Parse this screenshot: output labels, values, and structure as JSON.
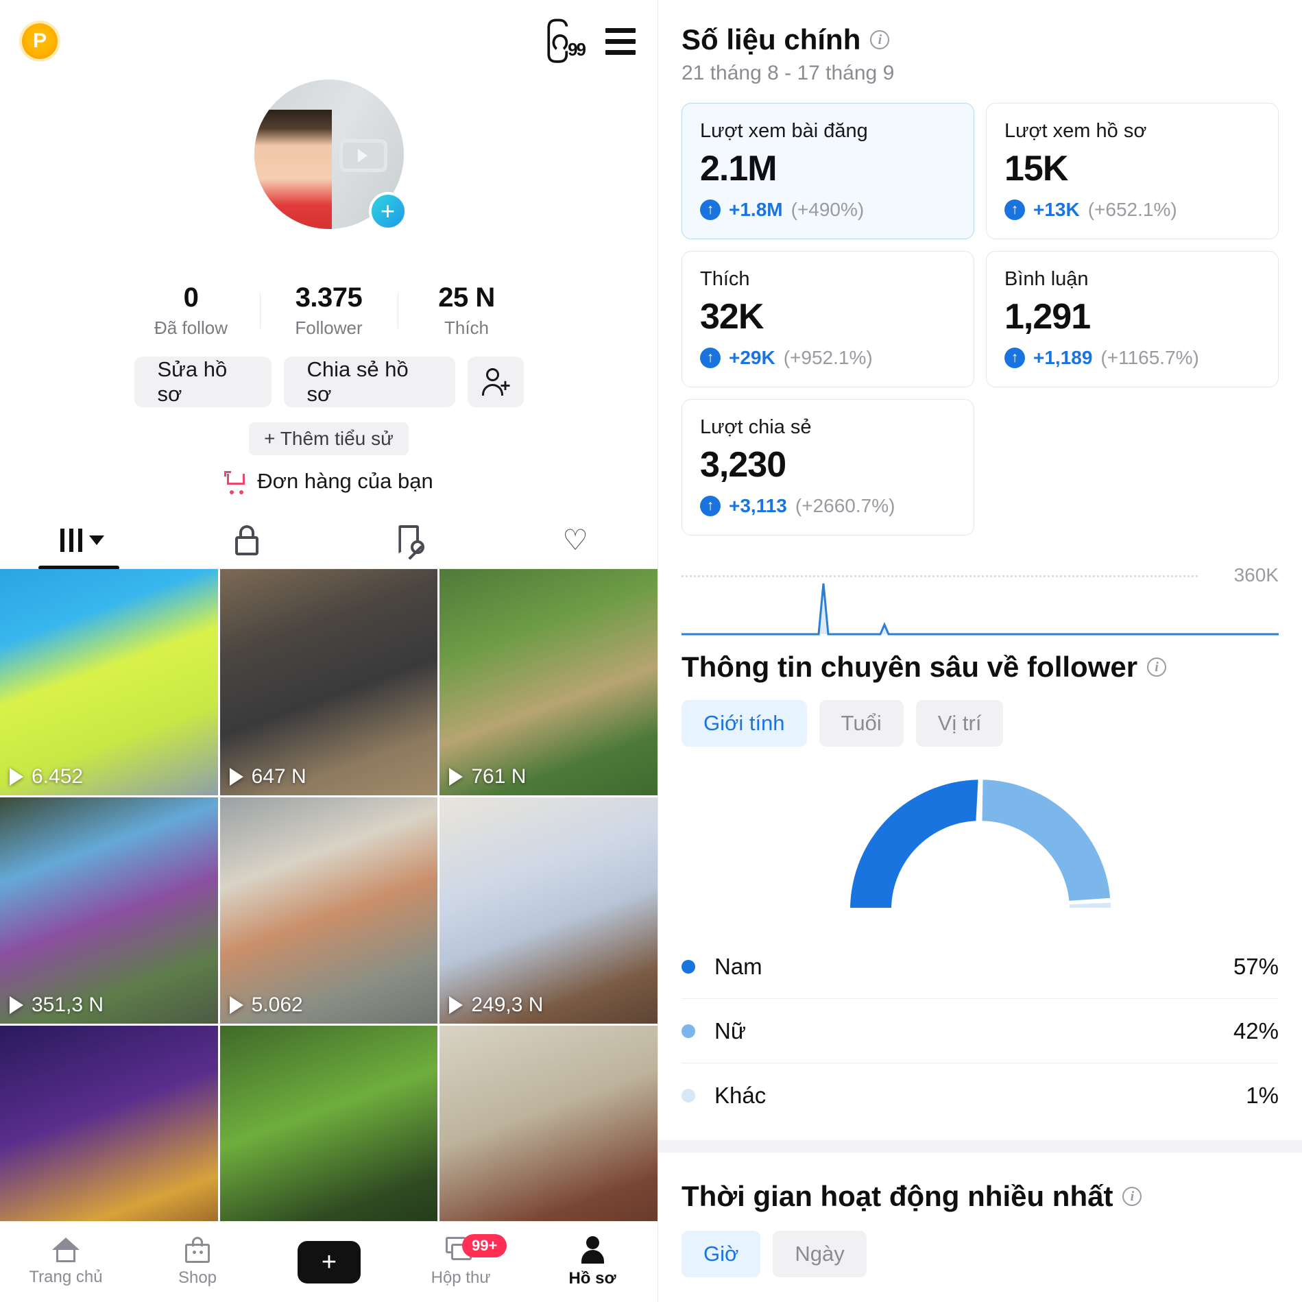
{
  "left": {
    "topbar": {
      "coin_label": "P",
      "glyph_label": "99",
      "menu_icon": "hamburger-icon"
    },
    "profile": {
      "username_redacted": "",
      "add_icon": "plus-icon",
      "stats": [
        {
          "num": "0",
          "label": "Đã follow"
        },
        {
          "num": "3.375",
          "label": "Follower"
        },
        {
          "num": "25 N",
          "label": "Thích"
        }
      ],
      "edit_button": "Sửa hồ sơ",
      "share_button": "Chia sẻ hồ sơ",
      "adduser_icon": "add-user-icon",
      "bio_button": "+ Thêm tiểu sử",
      "orders_label": "Đơn hàng của bạn",
      "orders_icon": "shopping-cart-icon"
    },
    "tabs": [
      {
        "icon": "grid-icon",
        "active": true
      },
      {
        "icon": "lock-icon",
        "active": false
      },
      {
        "icon": "bookmark-off-icon",
        "active": false
      },
      {
        "icon": "heart-icon",
        "active": false
      }
    ],
    "videos": [
      {
        "views": "6.452"
      },
      {
        "views": "647 N"
      },
      {
        "views": "761 N"
      },
      {
        "views": "351,3 N"
      },
      {
        "views": "5.062"
      },
      {
        "views": "249,3 N"
      }
    ],
    "bottom_nav": [
      {
        "label": "Trang chủ",
        "icon": "home-icon",
        "active": false
      },
      {
        "label": "Shop",
        "icon": "shop-icon",
        "active": false
      },
      {
        "label": "",
        "icon": "create-icon",
        "active": false
      },
      {
        "label": "Hộp thư",
        "icon": "inbox-icon",
        "badge": "99+",
        "active": false
      },
      {
        "label": "Hồ sơ",
        "icon": "profile-icon",
        "active": true
      }
    ]
  },
  "right": {
    "metrics": {
      "title": "Số liệu chính",
      "date_range": "21 tháng 8 - 17 tháng 9",
      "cards": [
        {
          "title": "Lượt xem bài đăng",
          "value": "2.1M",
          "delta": "+1.8M",
          "percent": "(+490%)",
          "selected": true
        },
        {
          "title": "Lượt xem hồ sơ",
          "value": "15K",
          "delta": "+13K",
          "percent": "(+652.1%)",
          "selected": false
        },
        {
          "title": "Thích",
          "value": "32K",
          "delta": "+29K",
          "percent": "(+952.1%)",
          "selected": false
        },
        {
          "title": "Bình luận",
          "value": "1,291",
          "delta": "+1,189",
          "percent": "(+1165.7%)",
          "selected": false
        },
        {
          "title": "Lượt chia sẻ",
          "value": "3,230",
          "delta": "+3,113",
          "percent": "(+2660.7%)",
          "selected": false
        }
      ],
      "gridline_label": "360K"
    },
    "follower_insights": {
      "title": "Thông tin chuyên sâu về follower",
      "tabs": [
        {
          "label": "Giới tính",
          "active": true
        },
        {
          "label": "Tuổi",
          "active": false
        },
        {
          "label": "Vị trí",
          "active": false
        }
      ]
    },
    "active_time": {
      "title": "Thời gian hoạt động nhiều nhất"
    },
    "colors": {
      "primary": "#1a74e0",
      "secondary": "#7cb7ec",
      "tertiary": "#d6e7f8"
    }
  },
  "chart_data": [
    {
      "type": "line",
      "title": "Lượt xem bài đăng",
      "ylabel": "",
      "ylim": [
        0,
        400000
      ],
      "gridlines": [
        360000
      ],
      "gridline_labels": [
        "360K"
      ],
      "x": [
        0,
        1,
        2,
        3,
        4,
        5,
        6,
        7,
        8,
        9,
        10,
        11,
        12,
        13,
        14,
        15,
        16,
        17,
        18,
        19,
        20,
        21,
        22,
        23,
        24,
        25,
        26,
        27
      ],
      "values": [
        0,
        0,
        0,
        0,
        0,
        0,
        0,
        0,
        0,
        0,
        0,
        2000,
        330000,
        4000,
        0,
        0,
        3000,
        60000,
        2000,
        0,
        0,
        0,
        0,
        0,
        0,
        0,
        0,
        0
      ],
      "grid": true,
      "legend": "none"
    },
    {
      "type": "pie",
      "title": "Giới tính",
      "categories": [
        "Nam",
        "Nữ",
        "Khác"
      ],
      "values": [
        57,
        42,
        1
      ],
      "value_labels": [
        "57%",
        "42%",
        "1%"
      ],
      "colors": [
        "#1a74e0",
        "#7cb7ec",
        "#d6e7f8"
      ],
      "legend": "bottom",
      "semicircle": true
    }
  ]
}
